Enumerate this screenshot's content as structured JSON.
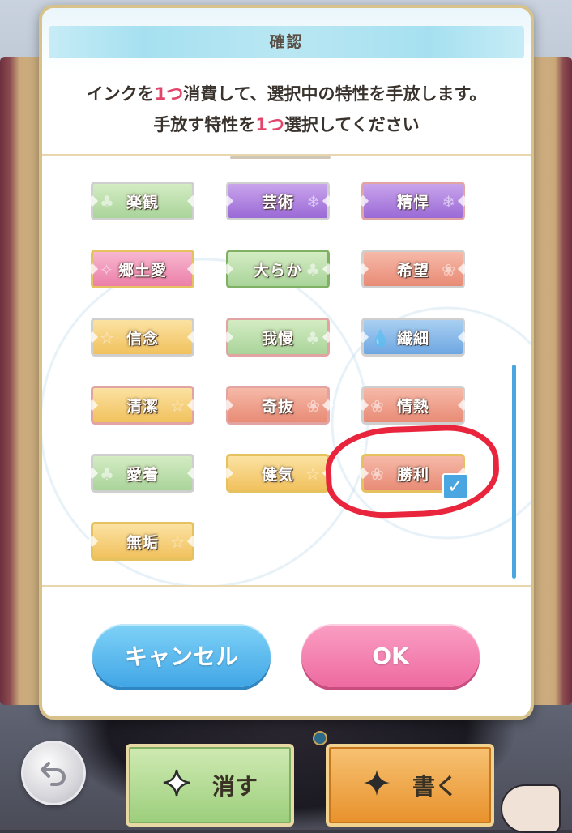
{
  "dialog": {
    "title": "確認",
    "message_line1_before": "インクを",
    "message_line1_count": "1つ",
    "message_line1_after": "消費して、選択中の特性を手放します。",
    "message_line2_before": "手放す特性を",
    "message_line2_count": "1つ",
    "message_line2_after": "選択してください",
    "cancel_label": "キャンセル",
    "ok_label": "OK"
  },
  "traits": [
    {
      "label": "楽観",
      "color": "green",
      "selected": false
    },
    {
      "label": "芸術",
      "color": "purple",
      "selected": false
    },
    {
      "label": "精悍",
      "color": "purple",
      "selected": false
    },
    {
      "label": "郷土愛",
      "color": "pink",
      "selected": false
    },
    {
      "label": "大らか",
      "color": "green",
      "selected": false
    },
    {
      "label": "希望",
      "color": "salmon",
      "selected": false
    },
    {
      "label": "信念",
      "color": "yellow",
      "selected": false
    },
    {
      "label": "我慢",
      "color": "green",
      "selected": false
    },
    {
      "label": "繊細",
      "color": "blue",
      "selected": false
    },
    {
      "label": "清潔",
      "color": "yellow",
      "selected": false
    },
    {
      "label": "奇抜",
      "color": "salmon",
      "selected": false
    },
    {
      "label": "情熱",
      "color": "salmon",
      "selected": false
    },
    {
      "label": "愛着",
      "color": "green",
      "selected": false
    },
    {
      "label": "健気",
      "color": "yellow",
      "selected": false
    },
    {
      "label": "勝利",
      "color": "salmon",
      "selected": true
    },
    {
      "label": "無垢",
      "color": "yellow",
      "selected": false
    }
  ],
  "bottom_bar": {
    "erase_label": "消す",
    "write_label": "書く"
  },
  "icons": {
    "back": "undo-arrow-icon",
    "erase": "sparkle-icon",
    "write": "sparkle-icon",
    "checkbox": "checkmark-icon"
  },
  "colors": {
    "accent_red": "#e2446a",
    "cancel_blue": "#41a6e6",
    "ok_pink": "#ee6aa0",
    "checkbox_blue": "#4aa6e0",
    "annotation_red": "#e8253c"
  }
}
